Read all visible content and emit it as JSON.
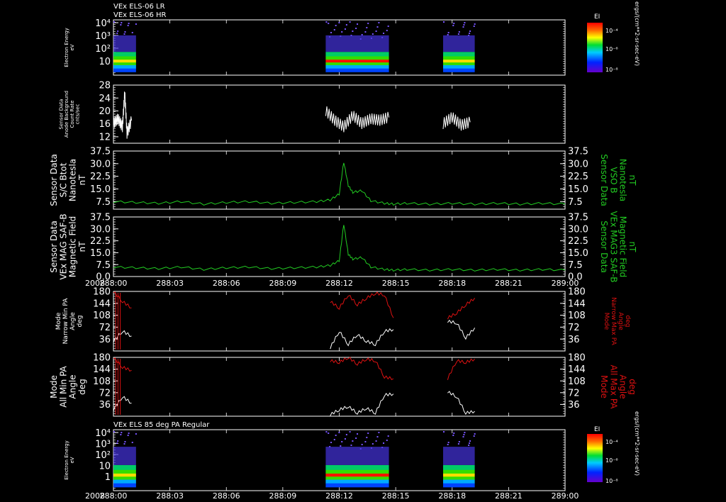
{
  "colors": {
    "white": "#ffffff",
    "green": "#22cc22",
    "red": "#dd1111",
    "bg": "#000000"
  },
  "header": {
    "line1": "VEx ELS-06 LR",
    "line2": "VEx ELS-06 HR",
    "bottom_panel_title": "VEx ELS 85 deg PA Regular"
  },
  "colorbars": {
    "title": "EI",
    "unit": "ergs/(cm**2-sr-sec-eV)",
    "top_ticks": [
      "10⁻⁴",
      "10⁻⁶",
      "10⁻⁸"
    ],
    "bottom_ticks": [
      "10⁻⁴",
      "10⁻⁶",
      "10⁻⁸"
    ]
  },
  "x_axis": {
    "year_label": "2008",
    "ticks": [
      "288:00",
      "288:03",
      "288:06",
      "288:09",
      "288:12",
      "288:15",
      "288:18",
      "288:21",
      "289:00"
    ]
  },
  "chart_data": [
    {
      "id": "spectrogram-lr-hr",
      "type": "heatmap",
      "ylabel": [
        "Electron Energy",
        "eV"
      ],
      "yscale": "log",
      "ytick_labels": [
        "10",
        "10²",
        "10³",
        "10⁴"
      ],
      "data_blocks_x": [
        [
          288.0,
          288.05
        ],
        [
          288.47,
          288.61
        ],
        [
          288.73,
          288.8
        ]
      ]
    },
    {
      "id": "anode-background",
      "type": "line",
      "ylabel": [
        "Sensor Data",
        "Anode Background",
        "Count Rate",
        "cnts/sec"
      ],
      "ylim": [
        10,
        28
      ],
      "ytick_labels": [
        "12",
        "16",
        "20",
        "24",
        "28"
      ],
      "series": [
        {
          "x": [
            288.0,
            288.01,
            288.02,
            288.025,
            288.03,
            288.04
          ],
          "values": [
            16,
            17.5,
            15,
            25.5,
            13,
            17
          ]
        },
        {
          "x": [
            288.47,
            288.49,
            288.51,
            288.53,
            288.55,
            288.57,
            288.59,
            288.61
          ],
          "values": [
            20,
            17,
            15,
            18.5,
            16,
            17.5,
            17,
            18
          ]
        },
        {
          "x": [
            288.73,
            288.75,
            288.77,
            288.79
          ],
          "values": [
            16,
            18,
            15.5,
            16.5
          ]
        }
      ]
    },
    {
      "id": "sc-bmag",
      "type": "line",
      "left_label": [
        "Sensor Data",
        "S/C Btot",
        "Nanotesla",
        "nT"
      ],
      "right_label": [
        "Sensor Data",
        "VSO B",
        "Nanotesla",
        "nT"
      ],
      "ylim": [
        3,
        37.5
      ],
      "ytick_labels": [
        "7.5",
        "15.0",
        "22.5",
        "30.0",
        "37.5"
      ],
      "x": [
        288.0,
        288.05,
        288.1,
        288.15,
        288.2,
        288.25,
        288.3,
        288.35,
        288.4,
        288.45,
        288.48,
        288.5,
        288.51,
        288.52,
        288.53,
        288.55,
        288.57,
        288.6,
        288.62,
        288.65,
        288.7,
        288.75,
        288.8,
        288.85,
        288.9,
        288.95,
        289.0
      ],
      "values": [
        7.5,
        7,
        6.5,
        7.5,
        6,
        7,
        7.5,
        6.5,
        7,
        7.5,
        8.5,
        12,
        31,
        17,
        13,
        14,
        8,
        6.5,
        6,
        6.5,
        6,
        6.5,
        6,
        6.5,
        6,
        6.5,
        6
      ]
    },
    {
      "id": "mag3-saf-b",
      "type": "line",
      "left_label": [
        "Sensor Data",
        "VEx MAG SAF-B",
        "Magnetic Field",
        "nT"
      ],
      "right_label": [
        "Sensor Data",
        "VEx MAG3 SAF-B",
        "Magnetic Field",
        "nT"
      ],
      "ylim": [
        0,
        37.5
      ],
      "ytick_labels": [
        "0.0",
        "7.5",
        "15.0",
        "22.5",
        "30.0",
        "37.5"
      ],
      "x": [
        288.0,
        288.05,
        288.1,
        288.15,
        288.2,
        288.25,
        288.3,
        288.35,
        288.4,
        288.45,
        288.48,
        288.5,
        288.51,
        288.52,
        288.53,
        288.55,
        288.57,
        288.6,
        288.62,
        288.65,
        288.7,
        288.75,
        288.8,
        288.85,
        288.9,
        288.95,
        289.0
      ],
      "values": [
        6,
        5.5,
        5,
        6,
        4.5,
        5.5,
        6,
        5,
        5.5,
        6,
        7,
        10,
        33,
        14,
        11,
        12,
        6,
        4.5,
        4,
        4.5,
        4,
        4.5,
        4,
        4.5,
        4,
        4.5,
        4
      ]
    },
    {
      "id": "narrow-pa",
      "type": "line",
      "left_label": [
        "Mode",
        "Narrow Min PA",
        "Angle",
        "deg"
      ],
      "right_label": [
        "Mode",
        "Narrow Max PA",
        "Angle",
        "deg"
      ],
      "ylim": [
        0,
        180
      ],
      "ytick_labels": [
        "36",
        "72",
        "108",
        "144",
        "180"
      ],
      "series": [
        {
          "name": "Narrow Max PA",
          "color": "red",
          "x": [
            288.0,
            288.02,
            288.04,
            288.48,
            288.5,
            288.52,
            288.54,
            288.56,
            288.58,
            288.6,
            288.62,
            288.74,
            288.76,
            288.78,
            288.8
          ],
          "values": [
            180,
            150,
            130,
            150,
            130,
            170,
            140,
            160,
            175,
            170,
            100,
            100,
            115,
            140,
            160
          ]
        },
        {
          "name": "Narrow Min PA",
          "color": "white",
          "x": [
            288.0,
            288.02,
            288.04,
            288.48,
            288.5,
            288.52,
            288.54,
            288.56,
            288.58,
            288.6,
            288.62,
            288.74,
            288.76,
            288.78,
            288.8
          ],
          "values": [
            30,
            60,
            45,
            10,
            60,
            20,
            50,
            30,
            20,
            60,
            65,
            90,
            85,
            40,
            70
          ]
        }
      ]
    },
    {
      "id": "all-pa",
      "type": "line",
      "left_label": [
        "Mode",
        "All Min PA",
        "Angle",
        "deg"
      ],
      "right_label": [
        "Mode",
        "All Max PA",
        "Angle",
        "deg"
      ],
      "ylim": [
        0,
        180
      ],
      "ytick_labels": [
        "36",
        "72",
        "108",
        "144",
        "180"
      ],
      "series": [
        {
          "name": "All Max PA",
          "color": "red",
          "x": [
            288.0,
            288.02,
            288.04,
            288.48,
            288.5,
            288.52,
            288.54,
            288.56,
            288.58,
            288.6,
            288.62,
            288.74,
            288.76,
            288.78,
            288.8
          ],
          "values": [
            180,
            150,
            140,
            170,
            165,
            180,
            160,
            175,
            170,
            120,
            115,
            115,
            170,
            165,
            175
          ]
        },
        {
          "name": "All Min PA",
          "color": "white",
          "x": [
            288.0,
            288.02,
            288.04,
            288.48,
            288.5,
            288.52,
            288.54,
            288.56,
            288.58,
            288.6,
            288.62,
            288.74,
            288.76,
            288.78,
            288.8
          ],
          "values": [
            20,
            60,
            40,
            5,
            20,
            30,
            10,
            25,
            10,
            65,
            68,
            75,
            60,
            10,
            15
          ]
        }
      ]
    },
    {
      "id": "spectrogram-85pa",
      "type": "heatmap",
      "ylabel": [
        "Electron Energy",
        "eV"
      ],
      "yscale": "log",
      "ytick_labels": [
        "1",
        "10",
        "10²",
        "10³",
        "10⁴"
      ],
      "data_blocks_x": [
        [
          288.0,
          288.05
        ],
        [
          288.47,
          288.61
        ],
        [
          288.73,
          288.8
        ]
      ]
    }
  ]
}
